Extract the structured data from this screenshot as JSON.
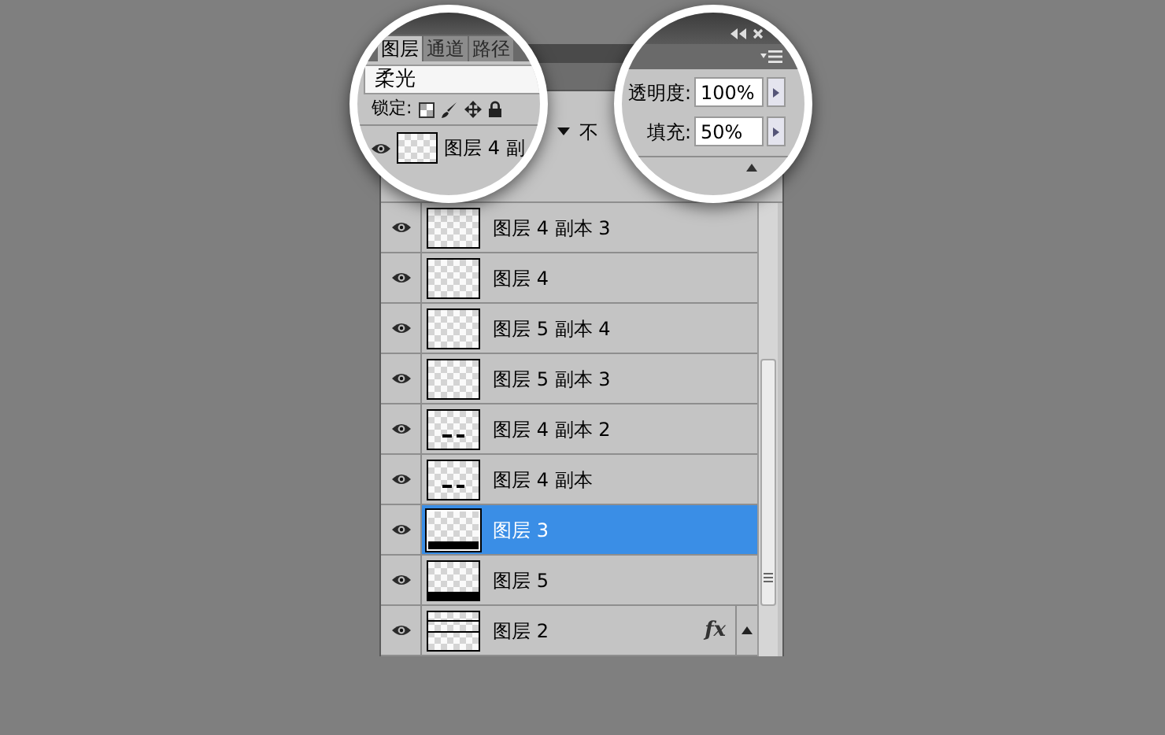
{
  "magnifier_left": {
    "tabs": [
      {
        "label": "图层",
        "selected": true
      },
      {
        "label": "通道",
        "selected": false
      },
      {
        "label": "路径",
        "selected": false
      }
    ],
    "blend_mode": "柔光",
    "lock_label": "锁定:",
    "layer_preview": {
      "name": "图层 4 副",
      "visible": true
    }
  },
  "magnifier_right": {
    "opacity": {
      "label": "透明度:",
      "value": "100%"
    },
    "fill": {
      "label": "填充:",
      "value": "50%"
    }
  },
  "options_fragment": {
    "opacity_label": "不"
  },
  "layers": [
    {
      "name": "图层 4 副本 3",
      "kind": "plain",
      "visible": true,
      "selected": false
    },
    {
      "name": "图层 4",
      "kind": "plain",
      "visible": true,
      "selected": false
    },
    {
      "name": "图层 5 副本 4",
      "kind": "plain",
      "visible": true,
      "selected": false
    },
    {
      "name": "图层 5 副本 3",
      "kind": "plain",
      "visible": true,
      "selected": false
    },
    {
      "name": "图层 4 副本 2",
      "kind": "dashes",
      "visible": true,
      "selected": false
    },
    {
      "name": "图层 4 副本",
      "kind": "dashes",
      "visible": true,
      "selected": false
    },
    {
      "name": "图层 3",
      "kind": "bottom-bar",
      "visible": true,
      "selected": true
    },
    {
      "name": "图层 5",
      "kind": "bottom-bar",
      "visible": true,
      "selected": false
    },
    {
      "name": "图层 2",
      "kind": "lines",
      "visible": true,
      "selected": false,
      "effects_badge": "fx"
    }
  ]
}
